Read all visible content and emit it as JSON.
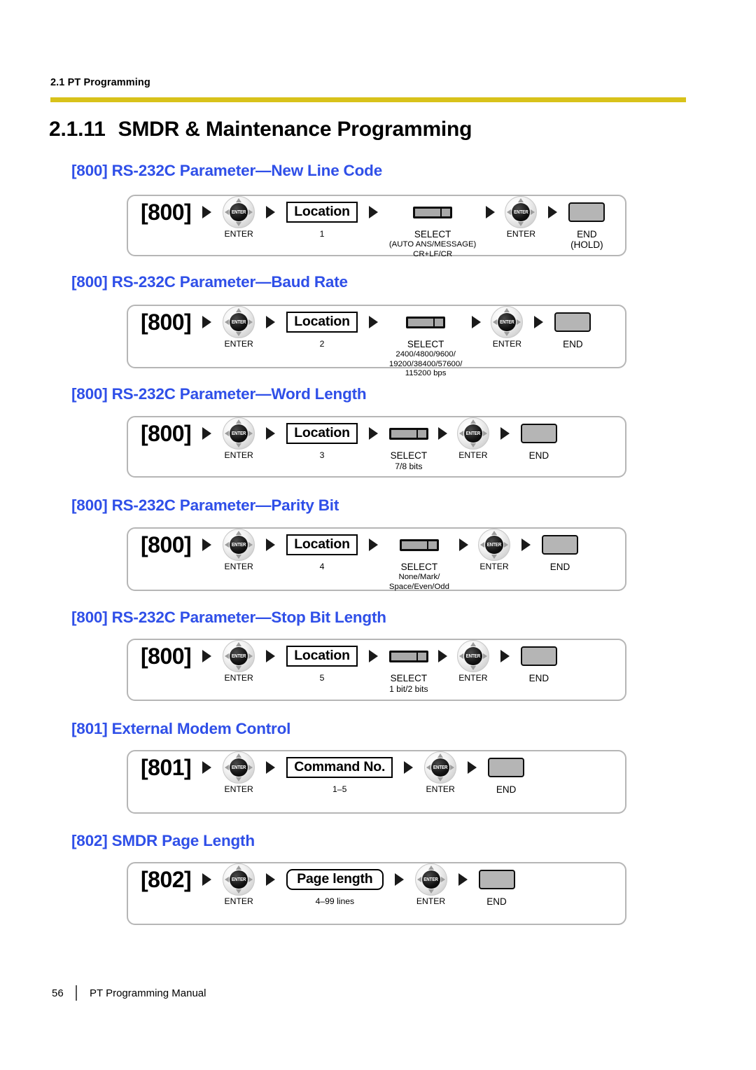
{
  "header": {
    "running_head": "2.1 PT Programming",
    "rule_color": "#d8c21a"
  },
  "section": {
    "number": "2.1.11",
    "title": "SMDR & Maintenance Programming"
  },
  "theme": {
    "heading_blue": "#2f4fe8",
    "box_border": "#b6b6b6",
    "key_gray": "#b5b5b5"
  },
  "icons": {
    "nav_key": "navigator-key",
    "enter_text": "ENTER",
    "select_key": "select-key",
    "end_key": "end-key",
    "arrow": "arrow-right-triangle"
  },
  "blocks": [
    {
      "id": "800-new-line-code",
      "heading": "[800] RS-232C Parameter—New Line Code",
      "code": "[800]",
      "steps": [
        {
          "kind": "code",
          "label": "[800]"
        },
        {
          "kind": "nav",
          "caption": "ENTER"
        },
        {
          "kind": "entry",
          "label": "Location",
          "caption": "1"
        },
        {
          "kind": "select",
          "caption_lines": [
            "SELECT",
            "(AUTO ANS/MESSAGE)",
            "CR+LF/CR"
          ]
        },
        {
          "kind": "nav",
          "caption": "ENTER"
        },
        {
          "kind": "end",
          "caption_lines": [
            "END",
            "(HOLD)"
          ]
        }
      ]
    },
    {
      "id": "800-baud-rate",
      "heading": "[800] RS-232C Parameter—Baud Rate",
      "code": "[800]",
      "steps": [
        {
          "kind": "code",
          "label": "[800]"
        },
        {
          "kind": "nav",
          "caption": "ENTER"
        },
        {
          "kind": "entry",
          "label": "Location",
          "caption": "2"
        },
        {
          "kind": "select",
          "caption_lines": [
            "SELECT",
            "2400/4800/9600/",
            "19200/38400/57600/",
            "115200 bps"
          ]
        },
        {
          "kind": "nav",
          "caption": "ENTER"
        },
        {
          "kind": "end",
          "caption_lines": [
            "END"
          ]
        }
      ]
    },
    {
      "id": "800-word-length",
      "heading": "[800] RS-232C Parameter—Word Length",
      "code": "[800]",
      "steps": [
        {
          "kind": "code",
          "label": "[800]"
        },
        {
          "kind": "nav",
          "caption": "ENTER"
        },
        {
          "kind": "entry",
          "label": "Location",
          "caption": "3"
        },
        {
          "kind": "select",
          "caption_lines": [
            "SELECT",
            "7/8 bits"
          ]
        },
        {
          "kind": "nav",
          "caption": "ENTER"
        },
        {
          "kind": "end",
          "caption_lines": [
            "END"
          ]
        }
      ]
    },
    {
      "id": "800-parity-bit",
      "heading": "[800] RS-232C Parameter—Parity Bit",
      "code": "[800]",
      "steps": [
        {
          "kind": "code",
          "label": "[800]"
        },
        {
          "kind": "nav",
          "caption": "ENTER"
        },
        {
          "kind": "entry",
          "label": "Location",
          "caption": "4"
        },
        {
          "kind": "select",
          "caption_lines": [
            "SELECT",
            "None/Mark/",
            "Space/Even/Odd"
          ]
        },
        {
          "kind": "nav",
          "caption": "ENTER"
        },
        {
          "kind": "end",
          "caption_lines": [
            "END"
          ]
        }
      ]
    },
    {
      "id": "800-stop-bit-length",
      "heading": "[800] RS-232C Parameter—Stop Bit Length",
      "code": "[800]",
      "steps": [
        {
          "kind": "code",
          "label": "[800]"
        },
        {
          "kind": "nav",
          "caption": "ENTER"
        },
        {
          "kind": "entry",
          "label": "Location",
          "caption": "5"
        },
        {
          "kind": "select",
          "caption_lines": [
            "SELECT",
            "1 bit/2 bits"
          ]
        },
        {
          "kind": "nav",
          "caption": "ENTER"
        },
        {
          "kind": "end",
          "caption_lines": [
            "END"
          ]
        }
      ]
    },
    {
      "id": "801-external-modem-control",
      "heading": "[801] External Modem Control",
      "code": "[801]",
      "steps": [
        {
          "kind": "code",
          "label": "[801]"
        },
        {
          "kind": "nav",
          "caption": "ENTER"
        },
        {
          "kind": "entry",
          "label": "Command No.",
          "caption": "1–5"
        },
        {
          "kind": "nav",
          "caption": "ENTER"
        },
        {
          "kind": "end",
          "caption_lines": [
            "END"
          ]
        }
      ]
    },
    {
      "id": "802-smdr-page-length",
      "heading": "[802] SMDR Page Length",
      "code": "[802]",
      "steps": [
        {
          "kind": "code",
          "label": "[802]"
        },
        {
          "kind": "nav",
          "caption": "ENTER"
        },
        {
          "kind": "entry",
          "label": "Page length",
          "rounded": true,
          "caption": "4–99 lines"
        },
        {
          "kind": "nav",
          "caption": "ENTER"
        },
        {
          "kind": "end",
          "caption_lines": [
            "END"
          ]
        }
      ]
    }
  ],
  "footer": {
    "page_number": "56",
    "manual_title": "PT Programming Manual"
  }
}
